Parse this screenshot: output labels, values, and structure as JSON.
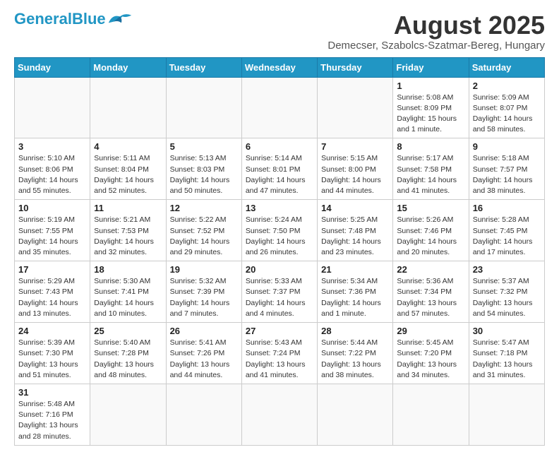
{
  "header": {
    "logo_general": "General",
    "logo_blue": "Blue",
    "title": "August 2025",
    "subtitle": "Demecser, Szabolcs-Szatmar-Bereg, Hungary"
  },
  "weekdays": [
    "Sunday",
    "Monday",
    "Tuesday",
    "Wednesday",
    "Thursday",
    "Friday",
    "Saturday"
  ],
  "weeks": [
    [
      {
        "day": "",
        "info": ""
      },
      {
        "day": "",
        "info": ""
      },
      {
        "day": "",
        "info": ""
      },
      {
        "day": "",
        "info": ""
      },
      {
        "day": "",
        "info": ""
      },
      {
        "day": "1",
        "info": "Sunrise: 5:08 AM\nSunset: 8:09 PM\nDaylight: 15 hours and 1 minute."
      },
      {
        "day": "2",
        "info": "Sunrise: 5:09 AM\nSunset: 8:07 PM\nDaylight: 14 hours and 58 minutes."
      }
    ],
    [
      {
        "day": "3",
        "info": "Sunrise: 5:10 AM\nSunset: 8:06 PM\nDaylight: 14 hours and 55 minutes."
      },
      {
        "day": "4",
        "info": "Sunrise: 5:11 AM\nSunset: 8:04 PM\nDaylight: 14 hours and 52 minutes."
      },
      {
        "day": "5",
        "info": "Sunrise: 5:13 AM\nSunset: 8:03 PM\nDaylight: 14 hours and 50 minutes."
      },
      {
        "day": "6",
        "info": "Sunrise: 5:14 AM\nSunset: 8:01 PM\nDaylight: 14 hours and 47 minutes."
      },
      {
        "day": "7",
        "info": "Sunrise: 5:15 AM\nSunset: 8:00 PM\nDaylight: 14 hours and 44 minutes."
      },
      {
        "day": "8",
        "info": "Sunrise: 5:17 AM\nSunset: 7:58 PM\nDaylight: 14 hours and 41 minutes."
      },
      {
        "day": "9",
        "info": "Sunrise: 5:18 AM\nSunset: 7:57 PM\nDaylight: 14 hours and 38 minutes."
      }
    ],
    [
      {
        "day": "10",
        "info": "Sunrise: 5:19 AM\nSunset: 7:55 PM\nDaylight: 14 hours and 35 minutes."
      },
      {
        "day": "11",
        "info": "Sunrise: 5:21 AM\nSunset: 7:53 PM\nDaylight: 14 hours and 32 minutes."
      },
      {
        "day": "12",
        "info": "Sunrise: 5:22 AM\nSunset: 7:52 PM\nDaylight: 14 hours and 29 minutes."
      },
      {
        "day": "13",
        "info": "Sunrise: 5:24 AM\nSunset: 7:50 PM\nDaylight: 14 hours and 26 minutes."
      },
      {
        "day": "14",
        "info": "Sunrise: 5:25 AM\nSunset: 7:48 PM\nDaylight: 14 hours and 23 minutes."
      },
      {
        "day": "15",
        "info": "Sunrise: 5:26 AM\nSunset: 7:46 PM\nDaylight: 14 hours and 20 minutes."
      },
      {
        "day": "16",
        "info": "Sunrise: 5:28 AM\nSunset: 7:45 PM\nDaylight: 14 hours and 17 minutes."
      }
    ],
    [
      {
        "day": "17",
        "info": "Sunrise: 5:29 AM\nSunset: 7:43 PM\nDaylight: 14 hours and 13 minutes."
      },
      {
        "day": "18",
        "info": "Sunrise: 5:30 AM\nSunset: 7:41 PM\nDaylight: 14 hours and 10 minutes."
      },
      {
        "day": "19",
        "info": "Sunrise: 5:32 AM\nSunset: 7:39 PM\nDaylight: 14 hours and 7 minutes."
      },
      {
        "day": "20",
        "info": "Sunrise: 5:33 AM\nSunset: 7:37 PM\nDaylight: 14 hours and 4 minutes."
      },
      {
        "day": "21",
        "info": "Sunrise: 5:34 AM\nSunset: 7:36 PM\nDaylight: 14 hours and 1 minute."
      },
      {
        "day": "22",
        "info": "Sunrise: 5:36 AM\nSunset: 7:34 PM\nDaylight: 13 hours and 57 minutes."
      },
      {
        "day": "23",
        "info": "Sunrise: 5:37 AM\nSunset: 7:32 PM\nDaylight: 13 hours and 54 minutes."
      }
    ],
    [
      {
        "day": "24",
        "info": "Sunrise: 5:39 AM\nSunset: 7:30 PM\nDaylight: 13 hours and 51 minutes."
      },
      {
        "day": "25",
        "info": "Sunrise: 5:40 AM\nSunset: 7:28 PM\nDaylight: 13 hours and 48 minutes."
      },
      {
        "day": "26",
        "info": "Sunrise: 5:41 AM\nSunset: 7:26 PM\nDaylight: 13 hours and 44 minutes."
      },
      {
        "day": "27",
        "info": "Sunrise: 5:43 AM\nSunset: 7:24 PM\nDaylight: 13 hours and 41 minutes."
      },
      {
        "day": "28",
        "info": "Sunrise: 5:44 AM\nSunset: 7:22 PM\nDaylight: 13 hours and 38 minutes."
      },
      {
        "day": "29",
        "info": "Sunrise: 5:45 AM\nSunset: 7:20 PM\nDaylight: 13 hours and 34 minutes."
      },
      {
        "day": "30",
        "info": "Sunrise: 5:47 AM\nSunset: 7:18 PM\nDaylight: 13 hours and 31 minutes."
      }
    ],
    [
      {
        "day": "31",
        "info": "Sunrise: 5:48 AM\nSunset: 7:16 PM\nDaylight: 13 hours and 28 minutes."
      },
      {
        "day": "",
        "info": ""
      },
      {
        "day": "",
        "info": ""
      },
      {
        "day": "",
        "info": ""
      },
      {
        "day": "",
        "info": ""
      },
      {
        "day": "",
        "info": ""
      },
      {
        "day": "",
        "info": ""
      }
    ]
  ]
}
